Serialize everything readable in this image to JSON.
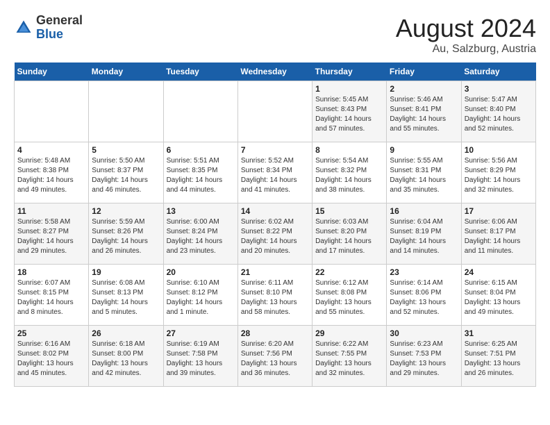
{
  "header": {
    "logo_general": "General",
    "logo_blue": "Blue",
    "month_title": "August 2024",
    "location": "Au, Salzburg, Austria"
  },
  "weekdays": [
    "Sunday",
    "Monday",
    "Tuesday",
    "Wednesday",
    "Thursday",
    "Friday",
    "Saturday"
  ],
  "weeks": [
    [
      {
        "day": "",
        "detail": ""
      },
      {
        "day": "",
        "detail": ""
      },
      {
        "day": "",
        "detail": ""
      },
      {
        "day": "",
        "detail": ""
      },
      {
        "day": "1",
        "detail": "Sunrise: 5:45 AM\nSunset: 8:43 PM\nDaylight: 14 hours\nand 57 minutes."
      },
      {
        "day": "2",
        "detail": "Sunrise: 5:46 AM\nSunset: 8:41 PM\nDaylight: 14 hours\nand 55 minutes."
      },
      {
        "day": "3",
        "detail": "Sunrise: 5:47 AM\nSunset: 8:40 PM\nDaylight: 14 hours\nand 52 minutes."
      }
    ],
    [
      {
        "day": "4",
        "detail": "Sunrise: 5:48 AM\nSunset: 8:38 PM\nDaylight: 14 hours\nand 49 minutes."
      },
      {
        "day": "5",
        "detail": "Sunrise: 5:50 AM\nSunset: 8:37 PM\nDaylight: 14 hours\nand 46 minutes."
      },
      {
        "day": "6",
        "detail": "Sunrise: 5:51 AM\nSunset: 8:35 PM\nDaylight: 14 hours\nand 44 minutes."
      },
      {
        "day": "7",
        "detail": "Sunrise: 5:52 AM\nSunset: 8:34 PM\nDaylight: 14 hours\nand 41 minutes."
      },
      {
        "day": "8",
        "detail": "Sunrise: 5:54 AM\nSunset: 8:32 PM\nDaylight: 14 hours\nand 38 minutes."
      },
      {
        "day": "9",
        "detail": "Sunrise: 5:55 AM\nSunset: 8:31 PM\nDaylight: 14 hours\nand 35 minutes."
      },
      {
        "day": "10",
        "detail": "Sunrise: 5:56 AM\nSunset: 8:29 PM\nDaylight: 14 hours\nand 32 minutes."
      }
    ],
    [
      {
        "day": "11",
        "detail": "Sunrise: 5:58 AM\nSunset: 8:27 PM\nDaylight: 14 hours\nand 29 minutes."
      },
      {
        "day": "12",
        "detail": "Sunrise: 5:59 AM\nSunset: 8:26 PM\nDaylight: 14 hours\nand 26 minutes."
      },
      {
        "day": "13",
        "detail": "Sunrise: 6:00 AM\nSunset: 8:24 PM\nDaylight: 14 hours\nand 23 minutes."
      },
      {
        "day": "14",
        "detail": "Sunrise: 6:02 AM\nSunset: 8:22 PM\nDaylight: 14 hours\nand 20 minutes."
      },
      {
        "day": "15",
        "detail": "Sunrise: 6:03 AM\nSunset: 8:20 PM\nDaylight: 14 hours\nand 17 minutes."
      },
      {
        "day": "16",
        "detail": "Sunrise: 6:04 AM\nSunset: 8:19 PM\nDaylight: 14 hours\nand 14 minutes."
      },
      {
        "day": "17",
        "detail": "Sunrise: 6:06 AM\nSunset: 8:17 PM\nDaylight: 14 hours\nand 11 minutes."
      }
    ],
    [
      {
        "day": "18",
        "detail": "Sunrise: 6:07 AM\nSunset: 8:15 PM\nDaylight: 14 hours\nand 8 minutes."
      },
      {
        "day": "19",
        "detail": "Sunrise: 6:08 AM\nSunset: 8:13 PM\nDaylight: 14 hours\nand 5 minutes."
      },
      {
        "day": "20",
        "detail": "Sunrise: 6:10 AM\nSunset: 8:12 PM\nDaylight: 14 hours\nand 1 minute."
      },
      {
        "day": "21",
        "detail": "Sunrise: 6:11 AM\nSunset: 8:10 PM\nDaylight: 13 hours\nand 58 minutes."
      },
      {
        "day": "22",
        "detail": "Sunrise: 6:12 AM\nSunset: 8:08 PM\nDaylight: 13 hours\nand 55 minutes."
      },
      {
        "day": "23",
        "detail": "Sunrise: 6:14 AM\nSunset: 8:06 PM\nDaylight: 13 hours\nand 52 minutes."
      },
      {
        "day": "24",
        "detail": "Sunrise: 6:15 AM\nSunset: 8:04 PM\nDaylight: 13 hours\nand 49 minutes."
      }
    ],
    [
      {
        "day": "25",
        "detail": "Sunrise: 6:16 AM\nSunset: 8:02 PM\nDaylight: 13 hours\nand 45 minutes."
      },
      {
        "day": "26",
        "detail": "Sunrise: 6:18 AM\nSunset: 8:00 PM\nDaylight: 13 hours\nand 42 minutes."
      },
      {
        "day": "27",
        "detail": "Sunrise: 6:19 AM\nSunset: 7:58 PM\nDaylight: 13 hours\nand 39 minutes."
      },
      {
        "day": "28",
        "detail": "Sunrise: 6:20 AM\nSunset: 7:56 PM\nDaylight: 13 hours\nand 36 minutes."
      },
      {
        "day": "29",
        "detail": "Sunrise: 6:22 AM\nSunset: 7:55 PM\nDaylight: 13 hours\nand 32 minutes."
      },
      {
        "day": "30",
        "detail": "Sunrise: 6:23 AM\nSunset: 7:53 PM\nDaylight: 13 hours\nand 29 minutes."
      },
      {
        "day": "31",
        "detail": "Sunrise: 6:25 AM\nSunset: 7:51 PM\nDaylight: 13 hours\nand 26 minutes."
      }
    ]
  ]
}
